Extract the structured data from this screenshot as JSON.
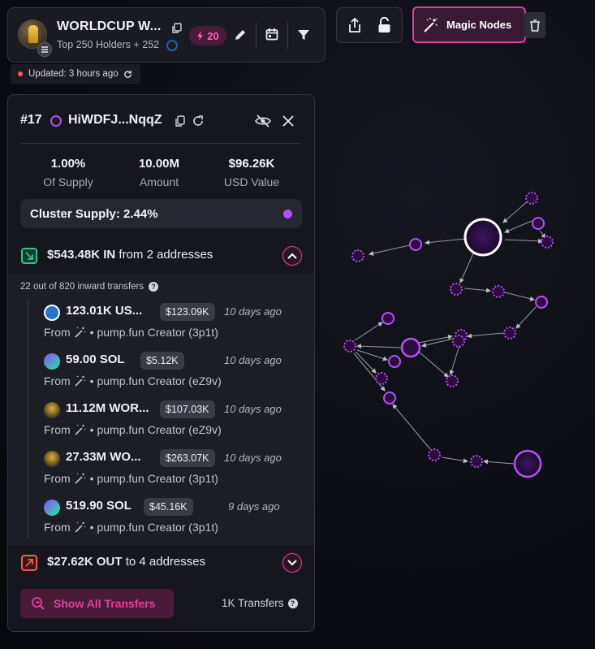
{
  "token": {
    "title": "WORLDCUP W...",
    "subtitle": "Top 250 Holders + 252",
    "energy": "20",
    "updated": "Updated: 3 hours ago"
  },
  "toolbar": {
    "magic_label": "Magic Nodes"
  },
  "holder": {
    "rank": "#17",
    "address": "HiWDFJ...NqqZ",
    "stats": [
      {
        "value": "1.00%",
        "label": "Of Supply"
      },
      {
        "value": "10.00M",
        "label": "Amount"
      },
      {
        "value": "$96.26K",
        "label": "USD Value"
      }
    ],
    "cluster_supply": "Cluster Supply: 2.44%",
    "inflow": {
      "amount": "$543.48K IN",
      "detail": "from 2 addresses",
      "count_note": "22 out of 820 inward transfers",
      "transfers": [
        {
          "token_icon": "usdc-icon",
          "amount": "123.01K US...",
          "usd": "$123.09K",
          "ago": "10 days ago",
          "from": "From",
          "source": "• pump.fun Creator (3p1t)"
        },
        {
          "token_icon": "sol-icon",
          "amount": "59.00 SOL",
          "usd": "$5.12K",
          "ago": "10 days ago",
          "from": "From",
          "source": "• pump.fun Creator (eZ9v)"
        },
        {
          "token_icon": "worldcup-icon",
          "amount": "11.12M WOR...",
          "usd": "$107.03K",
          "ago": "10 days ago",
          "from": "From",
          "source": "• pump.fun Creator (eZ9v)"
        },
        {
          "token_icon": "worldcup-icon",
          "amount": "27.33M WO...",
          "usd": "$263.07K",
          "ago": "10 days ago",
          "from": "From",
          "source": "• pump.fun Creator (3p1t)"
        },
        {
          "token_icon": "sol-icon",
          "amount": "519.90 SOL",
          "usd": "$45.16K",
          "ago": "9 days ago",
          "from": "From",
          "source": "• pump.fun Creator (3p1t)"
        }
      ]
    },
    "outflow": {
      "amount": "$27.62K OUT",
      "detail": "to 4 addresses"
    },
    "show_all_label": "Show All Transfers",
    "total_transfers": "1K Transfers"
  },
  "colors": {
    "accent": "#e0429e",
    "node": "#b650f5",
    "in": "#32c48d",
    "out": "#f05a5a"
  }
}
